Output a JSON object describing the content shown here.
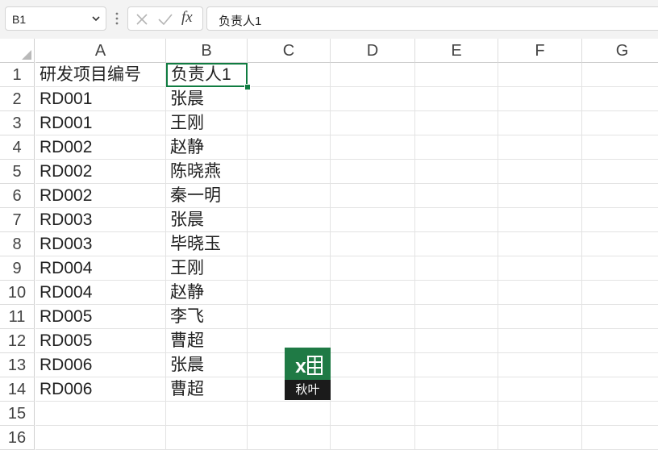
{
  "formula_bar": {
    "name_box": "B1",
    "fx_label": "fx",
    "formula_value": "负责人1"
  },
  "grid": {
    "columns": [
      "A",
      "B",
      "C",
      "D",
      "E",
      "F",
      "G"
    ],
    "rows": [
      "1",
      "2",
      "3",
      "4",
      "5",
      "6",
      "7",
      "8",
      "9",
      "10",
      "11",
      "12",
      "13",
      "14",
      "15",
      "16"
    ],
    "data": [
      [
        "研发项目编号",
        "负责人1"
      ],
      [
        "RD001",
        "张晨"
      ],
      [
        "RD001",
        "王刚"
      ],
      [
        "RD002",
        "赵静"
      ],
      [
        "RD002",
        "陈晓燕"
      ],
      [
        "RD002",
        "秦一明"
      ],
      [
        "RD003",
        "张晨"
      ],
      [
        "RD003",
        "毕晓玉"
      ],
      [
        "RD004",
        "王刚"
      ],
      [
        "RD004",
        "赵静"
      ],
      [
        "RD005",
        "李飞"
      ],
      [
        "RD005",
        "曹超"
      ],
      [
        "RD006",
        "张晨"
      ],
      [
        "RD006",
        "曹超"
      ]
    ],
    "selected_cell": "B1"
  },
  "logo": {
    "caption": "秋叶",
    "brand_color": "#1f7a45"
  },
  "colors": {
    "accent": "#107c41",
    "toolbar_bg": "#f3f3f3"
  }
}
